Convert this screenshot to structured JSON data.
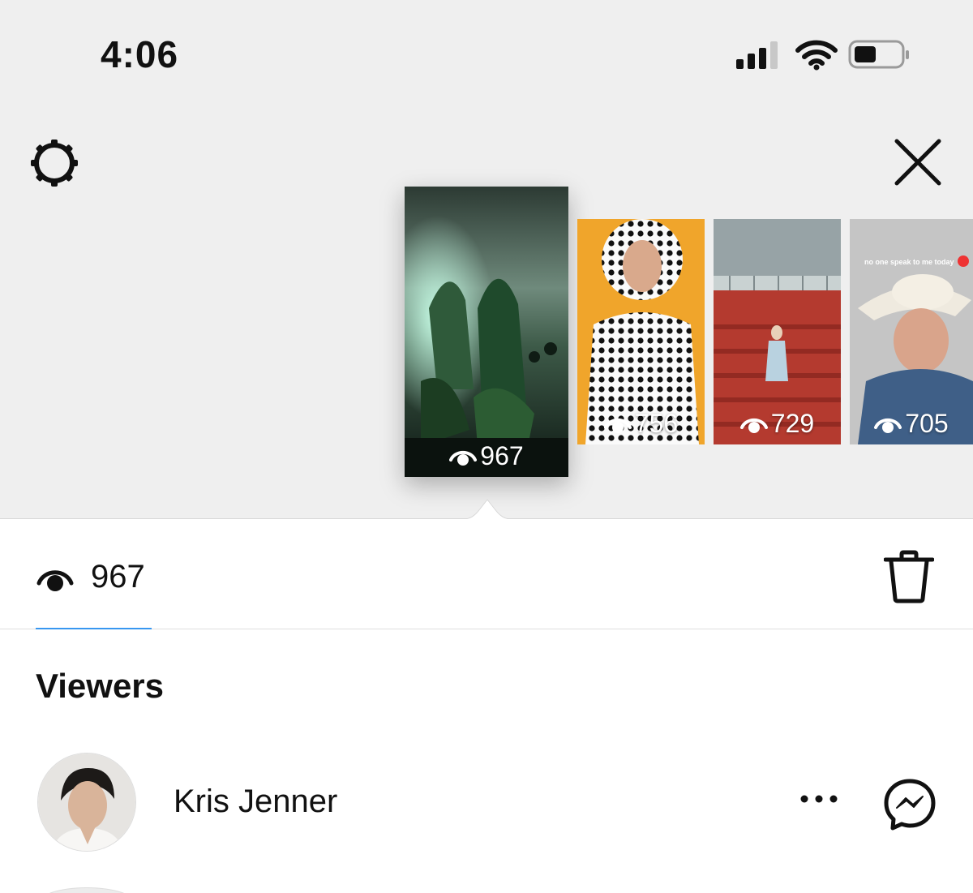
{
  "status_bar": {
    "time": "4:06",
    "icons": [
      "signal-icon",
      "wifi-icon",
      "battery-icon"
    ]
  },
  "header": {
    "settings_icon": "gear-icon",
    "close_icon": "close-icon"
  },
  "stories": [
    {
      "views": "967",
      "selected": true
    },
    {
      "views": "756",
      "selected": false
    },
    {
      "views": "729",
      "selected": false
    },
    {
      "views": "705",
      "selected": false,
      "caption": "no one speak to me today"
    }
  ],
  "views_bar": {
    "count": "967",
    "eye_icon": "eye-icon",
    "delete_icon": "trash-icon",
    "underline_color": "#3897f0"
  },
  "viewers": {
    "title": "Viewers",
    "items": [
      {
        "name": "Kris Jenner",
        "more_icon": "more-icon",
        "message_icon": "messenger-icon"
      }
    ]
  }
}
